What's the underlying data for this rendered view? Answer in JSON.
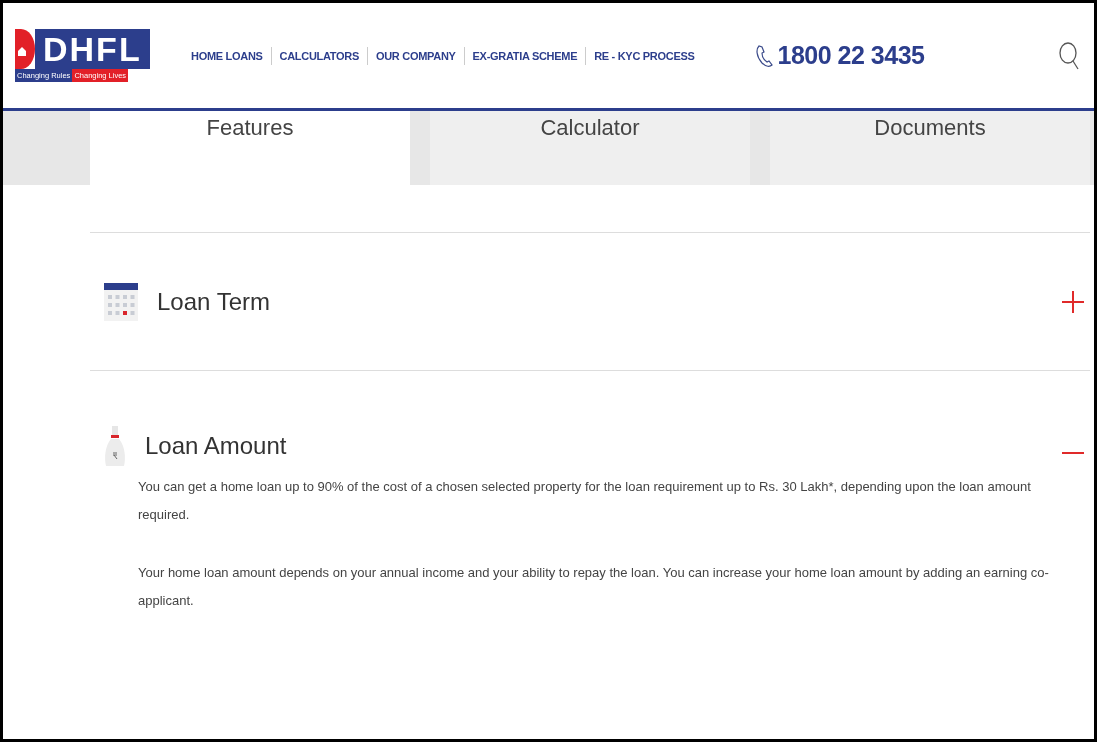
{
  "header": {
    "logo": {
      "wordmark": "DHFL",
      "tagline_part_1": "Changing Rules",
      "tagline_part_2": "Changing Lives"
    },
    "nav": [
      "HOME LOANS",
      "CALCULATORS",
      "OUR COMPANY",
      "EX-GRATIA SCHEME",
      "RE - KYC PROCESS"
    ],
    "phone": "1800 22 3435"
  },
  "tabs": [
    {
      "label": "Features",
      "selected": true
    },
    {
      "label": "Calculator",
      "selected": false
    },
    {
      "label": "Documents",
      "selected": false
    }
  ],
  "accordion": [
    {
      "title": "Loan Term",
      "expanded": false
    },
    {
      "title": "Loan Amount",
      "expanded": true,
      "paragraphs": [
        "You can get a home loan up to 90% of the cost of a chosen selected property for the loan requirement up to Rs. 30 Lakh*, depending upon the loan amount required.",
        "Your home loan amount depends on your annual income and your ability to repay the loan. You can increase your home loan amount by adding an earning co-applicant."
      ]
    }
  ]
}
